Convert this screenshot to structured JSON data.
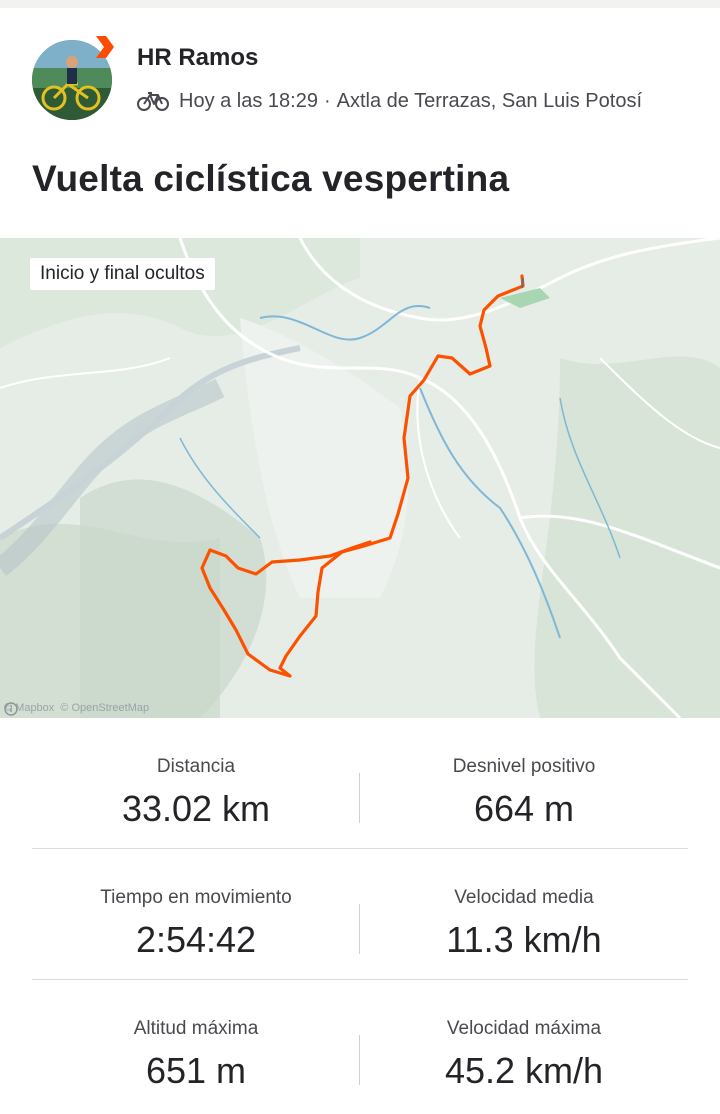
{
  "athlete": {
    "name": "HR Ramos",
    "time": "Hoy a las 18:29",
    "location": "Axtla de Terrazas, San Luis Potosí"
  },
  "activity": {
    "title": "Vuelta ciclística vespertina",
    "sport_icon": "bike-icon"
  },
  "map": {
    "privacy_label": "Inicio y final ocultos",
    "attribution_mapbox": "© Mapbox",
    "attribution_osm": "© OpenStreetMap",
    "route_color": "#fc5200"
  },
  "stats": [
    [
      {
        "label": "Distancia",
        "value": "33.02 km"
      },
      {
        "label": "Desnivel positivo",
        "value": "664 m"
      }
    ],
    [
      {
        "label": "Tiempo en movimiento",
        "value": "2:54:42"
      },
      {
        "label": "Velocidad media",
        "value": "11.3 km/h"
      }
    ],
    [
      {
        "label": "Altitud máxima",
        "value": "651 m"
      },
      {
        "label": "Velocidad máxima",
        "value": "45.2 km/h"
      }
    ]
  ],
  "colors": {
    "brand": "#fc4c02",
    "text": "#242428",
    "muted": "#494950"
  }
}
